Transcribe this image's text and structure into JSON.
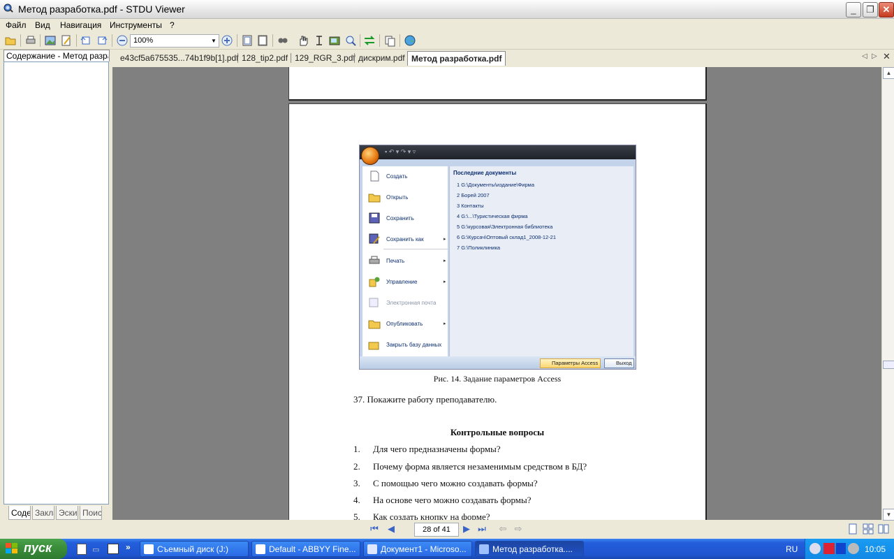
{
  "window": {
    "title": "Метод разработка.pdf - STDU Viewer"
  },
  "menu": [
    "Файл",
    "Вид",
    "Навигация",
    "Инструменты",
    "?"
  ],
  "toolbar": {
    "zoom": "100%"
  },
  "sidebar": {
    "tab": "Содержание - Метод разработка.pdf",
    "bottom_tabs": [
      "Содержание",
      "Закладки",
      "Эскизы",
      "Поиск"
    ]
  },
  "doc_tabs": [
    "e43cf5a675535...74b1f9b[1].pdf",
    "128_tip2.pdf",
    "129_RGR_3.pdf",
    "дискрим.pdf",
    "Метод разработка.pdf"
  ],
  "access": {
    "menu": [
      "Создать",
      "Открыть",
      "Сохранить",
      "Сохранить как",
      "Печать",
      "Управление",
      "Электронная почта",
      "Опубликовать",
      "Закрыть базу данных"
    ],
    "recent_title": "Последние документы",
    "recent": [
      "1 G:\\Документы\\издание\\Фирма",
      "2 Борей 2007",
      "3 Контакты",
      "4 G:\\...\\Туристическая фирма",
      "5 G:\\курсовая\\Электронная библиотека",
      "6 G:\\Курсач\\Оптовый склад1_2008-12-21",
      "7 G:\\Поликлиника"
    ],
    "params_btn": "Параметры Access",
    "exit_btn": "Выход"
  },
  "page": {
    "caption": "Рис. 14. Задание параметров Access",
    "step": "37. Покажите работу преподавателю.",
    "questions_title": "Контрольные вопросы",
    "questions": [
      {
        "num": "1.",
        "text": "Для чего предназначены формы?"
      },
      {
        "num": "2.",
        "text": "Почему форма является незаменимым средством в БД?"
      },
      {
        "num": "3.",
        "text": "С помощью чего можно создавать формы?"
      },
      {
        "num": "4.",
        "text": "На основе чего можно создавать формы?"
      },
      {
        "num": "5.",
        "text": "Как создать кнопку на форме?"
      }
    ]
  },
  "nav": {
    "page": "28 of 41"
  },
  "taskbar": {
    "start": "пуск",
    "tasks": [
      "Съемный диск (J:)",
      "Default - ABBYY Fine...",
      "Документ1 - Microso...",
      "Метод разработка...."
    ],
    "lang": "RU",
    "clock": "10:05"
  }
}
